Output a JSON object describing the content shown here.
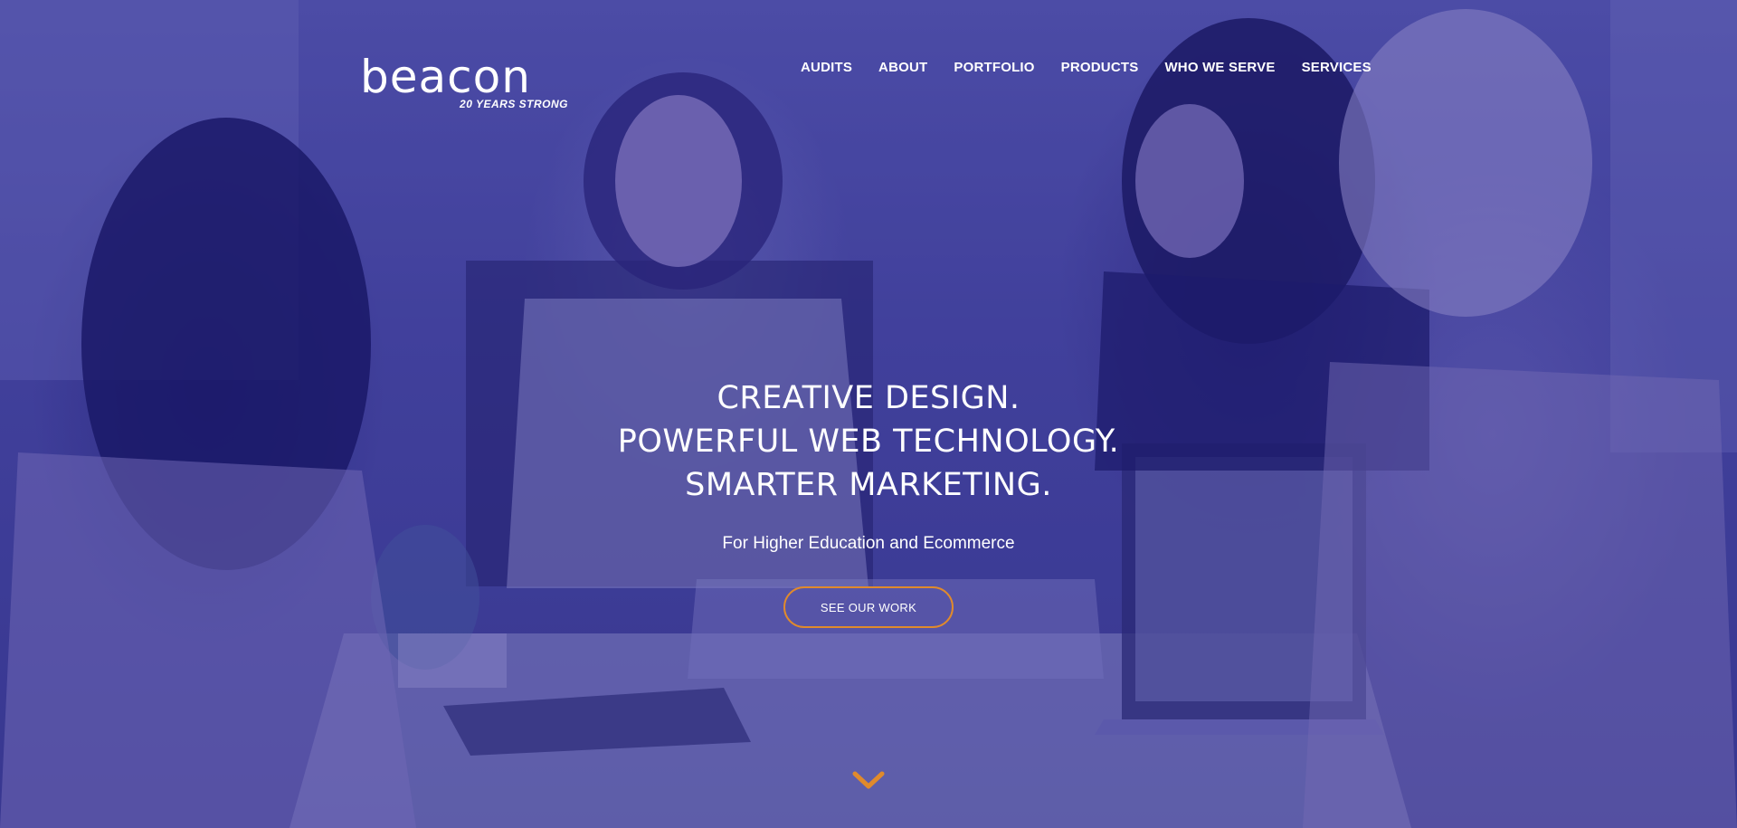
{
  "brand": {
    "logo_text": "beacon",
    "tagline": "20 YEARS STRONG"
  },
  "nav": {
    "items": [
      {
        "label": "AUDITS"
      },
      {
        "label": "ABOUT"
      },
      {
        "label": "PORTFOLIO"
      },
      {
        "label": "PRODUCTS"
      },
      {
        "label": "WHO WE SERVE"
      },
      {
        "label": "SERVICES"
      }
    ]
  },
  "hero": {
    "lines": [
      "CREATIVE DESIGN.",
      "POWERFUL WEB TECHNOLOGY.",
      "SMARTER MARKETING."
    ],
    "subtitle": "For Higher Education and Ecommerce",
    "cta_label": "SEE OUR WORK",
    "scroll_icon": "chevron-down-icon"
  },
  "colors": {
    "overlay": "#3b3a9a",
    "accent": "#e08a2c",
    "text": "#ffffff"
  }
}
